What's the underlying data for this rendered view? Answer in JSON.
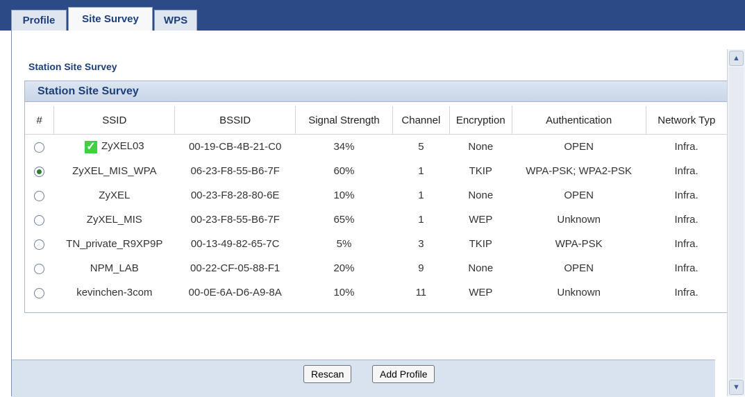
{
  "tabs": [
    {
      "label": "Profile",
      "active": false
    },
    {
      "label": "Site Survey",
      "active": true
    },
    {
      "label": "WPS",
      "active": false
    }
  ],
  "page_title": "Station Site Survey",
  "section_title": "Station Site Survey",
  "table": {
    "headers": [
      "#",
      "SSID",
      "BSSID",
      "Signal Strength",
      "Channel",
      "Encryption",
      "Authentication",
      "Network Typ"
    ],
    "rows": [
      {
        "selected": false,
        "connected": true,
        "ssid": "ZyXEL03",
        "bssid": "00-19-CB-4B-21-C0",
        "signal": "34%",
        "channel": "5",
        "encryption": "None",
        "auth": "OPEN",
        "network": "Infra."
      },
      {
        "selected": true,
        "connected": false,
        "ssid": "ZyXEL_MIS_WPA",
        "bssid": "06-23-F8-55-B6-7F",
        "signal": "60%",
        "channel": "1",
        "encryption": "TKIP",
        "auth": "WPA-PSK; WPA2-PSK",
        "network": "Infra."
      },
      {
        "selected": false,
        "connected": false,
        "ssid": "ZyXEL",
        "bssid": "00-23-F8-28-80-6E",
        "signal": "10%",
        "channel": "1",
        "encryption": "None",
        "auth": "OPEN",
        "network": "Infra."
      },
      {
        "selected": false,
        "connected": false,
        "ssid": "ZyXEL_MIS",
        "bssid": "00-23-F8-55-B6-7F",
        "signal": "65%",
        "channel": "1",
        "encryption": "WEP",
        "auth": "Unknown",
        "network": "Infra."
      },
      {
        "selected": false,
        "connected": false,
        "ssid": "TN_private_R9XP9P",
        "bssid": "00-13-49-82-65-7C",
        "signal": "5%",
        "channel": "3",
        "encryption": "TKIP",
        "auth": "WPA-PSK",
        "network": "Infra."
      },
      {
        "selected": false,
        "connected": false,
        "ssid": "NPM_LAB",
        "bssid": "00-22-CF-05-88-F1",
        "signal": "20%",
        "channel": "9",
        "encryption": "None",
        "auth": "OPEN",
        "network": "Infra."
      },
      {
        "selected": false,
        "connected": false,
        "ssid": "kevinchen-3com",
        "bssid": "00-0E-6A-D6-A9-8A",
        "signal": "10%",
        "channel": "11",
        "encryption": "WEP",
        "auth": "Unknown",
        "network": "Infra."
      }
    ]
  },
  "buttons": {
    "rescan": "Rescan",
    "add_profile": "Add Profile"
  },
  "icons": {
    "connected": "checkmark-icon",
    "scroll_up": "chevron-up-icon",
    "scroll_down": "chevron-down-icon"
  },
  "colors": {
    "tabbar": "#2c4a86",
    "heading": "#1d3f77",
    "connected_check": "#3fd13f"
  }
}
